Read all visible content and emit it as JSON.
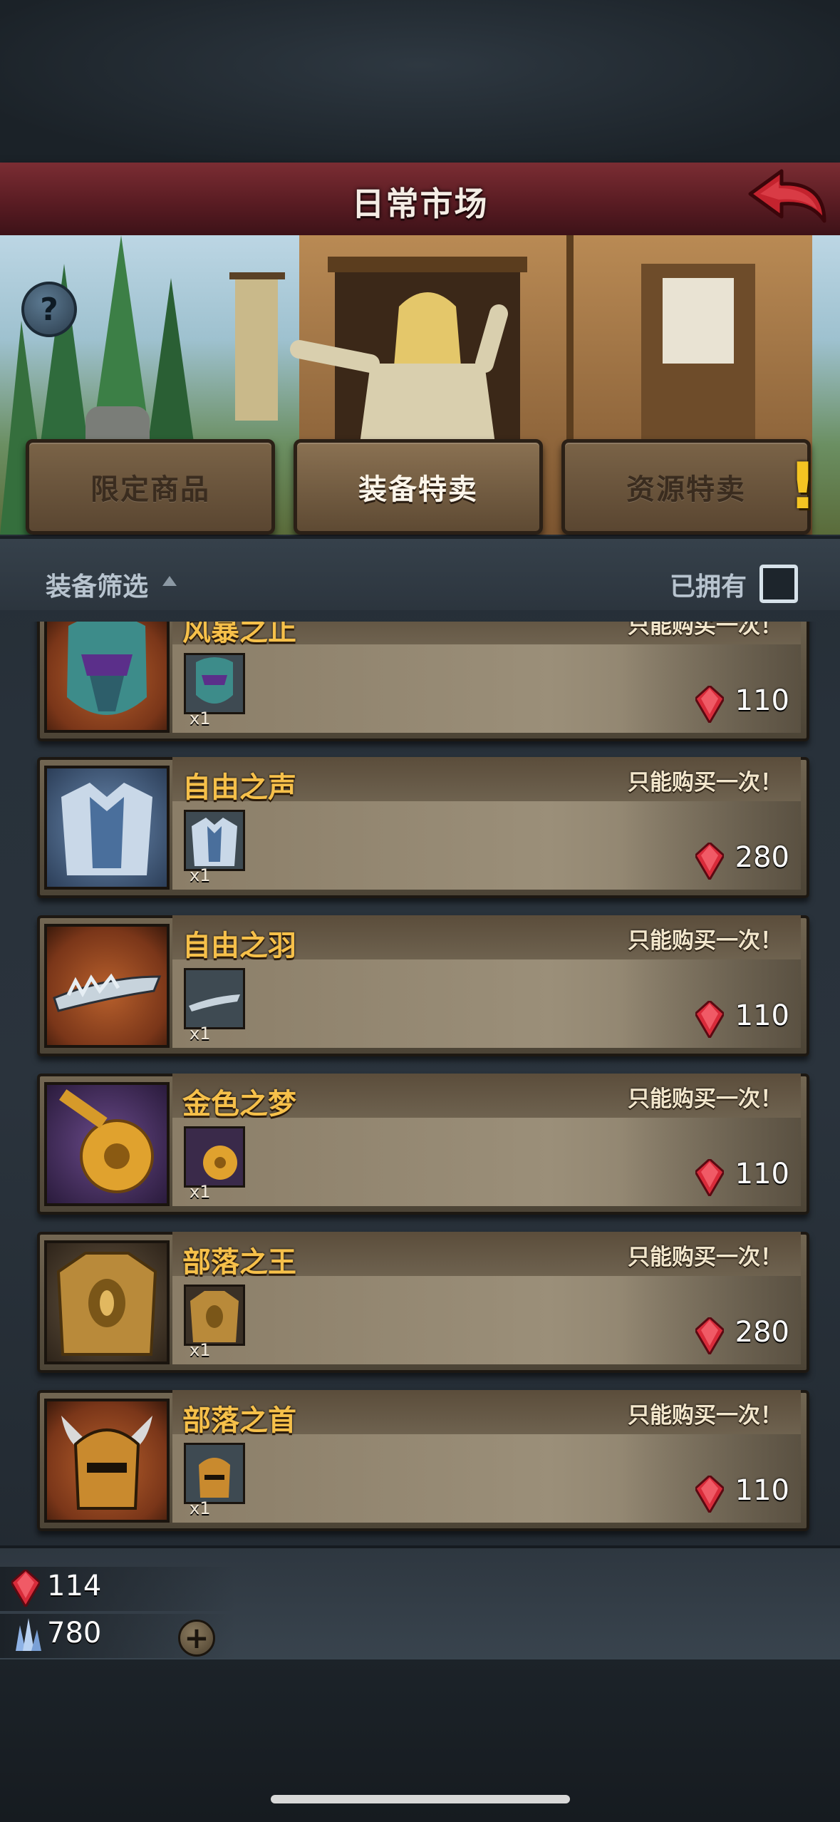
{
  "header": {
    "title": "日常市场"
  },
  "tabs": [
    {
      "label": "限定商品",
      "active": false
    },
    {
      "label": "装备特卖",
      "active": true
    },
    {
      "label": "资源特卖",
      "active": false,
      "alert": "!"
    }
  ],
  "filter": {
    "label": "装备筛选",
    "owned_label": "已拥有",
    "owned_checked": false
  },
  "items": [
    {
      "name": "风暴之止",
      "note": "只能购买一次！",
      "qty": "x1",
      "price": "110",
      "icon": "mask-icon"
    },
    {
      "name": "自由之声",
      "note": "只能购买一次！",
      "qty": "x1",
      "price": "280",
      "icon": "armor-icon"
    },
    {
      "name": "自由之羽",
      "note": "只能购买一次！",
      "qty": "x1",
      "price": "110",
      "icon": "circlet-icon"
    },
    {
      "name": "金色之梦",
      "note": "只能购买一次！",
      "qty": "x1",
      "price": "110",
      "icon": "lute-icon"
    },
    {
      "name": "部落之王",
      "note": "只能购买一次！",
      "qty": "x1",
      "price": "280",
      "icon": "golden-armor-icon"
    },
    {
      "name": "部落之首",
      "note": "只能购买一次！",
      "qty": "x1",
      "price": "110",
      "icon": "horned-helmet-icon"
    }
  ],
  "resources": {
    "rubies": "114",
    "crystals": "780"
  },
  "colors": {
    "title_bar": "#6b2129",
    "item_name": "#f6c04a",
    "ruby": "#d82b3a"
  }
}
